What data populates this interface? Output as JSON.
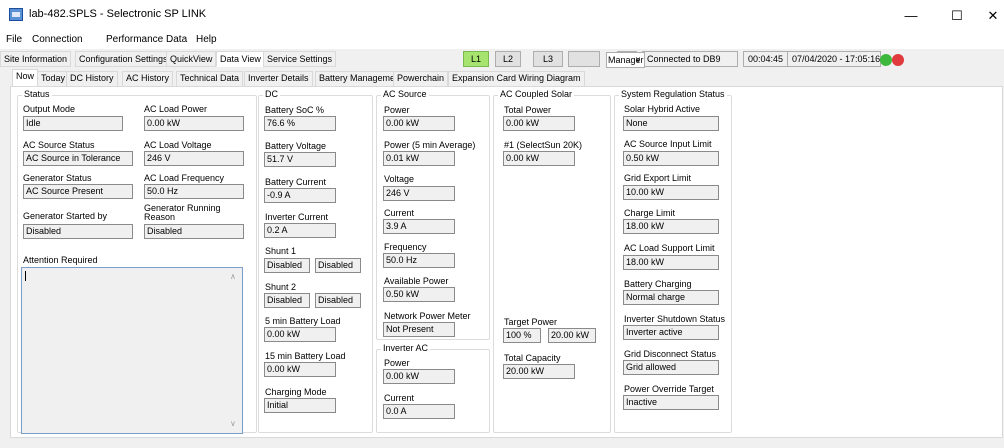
{
  "window": {
    "title": "lab-482.SPLS - Selectronic SP LINK"
  },
  "menu": [
    "File",
    "Connection",
    "Performance Data",
    "Help"
  ],
  "top_tabs": [
    "Site Information",
    "Configuration Settings",
    "QuickView",
    "Data View",
    "Service Settings"
  ],
  "phases": [
    "L1",
    "L2",
    "L3"
  ],
  "status": {
    "l1": "L1",
    "connection": "Connected to DB9",
    "elapsed": "00:04:45",
    "datetime": "07/04/2020 - 17:05:16"
  },
  "user": "Manager",
  "sub_tabs": [
    "Now",
    "Today",
    "DC History",
    "AC History",
    "Technical Data",
    "Inverter Details",
    "Battery Management",
    "Powerchain",
    "Expansion Card Wiring Diagram"
  ],
  "status_group": {
    "title": "Status",
    "output_mode_label": "Output Mode",
    "output_mode": "Idle",
    "ac_load_power_label": "AC Load Power",
    "ac_load_power": "0.00 kW",
    "ac_source_status_label": "AC Source Status",
    "ac_source_status": "AC Source in Tolerance",
    "ac_load_voltage_label": "AC Load Voltage",
    "ac_load_voltage": "246 V",
    "generator_status_label": "Generator Status",
    "generator_status": "AC Source Present",
    "ac_load_frequency_label": "AC Load Frequency",
    "ac_load_frequency": "50.0 Hz",
    "generator_started_by_label": "Generator Started by",
    "generator_started_by": "Disabled",
    "generator_running_reason_label": "Generator Running Reason",
    "generator_running_reason": "Disabled",
    "attention_label": "Attention Required"
  },
  "dc": {
    "title": "DC",
    "soc_label": "Battery SoC %",
    "soc": "76.6 %",
    "voltage_label": "Battery Voltage",
    "voltage": "51.7 V",
    "current_label": "Battery Current",
    "current": "-0.9 A",
    "inverter_current_label": "Inverter Current",
    "inverter_current": "0.2 A",
    "shunt1_label": "Shunt 1",
    "shunt1_a": "Disabled",
    "shunt1_b": "Disabled",
    "shunt2_label": "Shunt 2",
    "shunt2_a": "Disabled",
    "shunt2_b": "Disabled",
    "load5_label": "5 min Battery Load",
    "load5": "0.00 kW",
    "load15_label": "15 min Battery Load",
    "load15": "0.00 kW",
    "charging_mode_label": "Charging Mode",
    "charging_mode": "Initial"
  },
  "ac_source": {
    "title": "AC Source",
    "power_label": "Power",
    "power": "0.00 kW",
    "power5_label": "Power (5 min Average)",
    "power5": "0.01 kW",
    "voltage_label": "Voltage",
    "voltage": "246 V",
    "current_label": "Current",
    "current": "3.9 A",
    "frequency_label": "Frequency",
    "frequency": "50.0 Hz",
    "available_label": "Available Power",
    "available": "0.50 kW",
    "meter_label": "Network Power Meter",
    "meter": "Not Present"
  },
  "inverter_ac": {
    "title": "Inverter AC",
    "power_label": "Power",
    "power": "0.00 kW",
    "current_label": "Current",
    "current": "0.0 A"
  },
  "solar": {
    "title": "AC Coupled Solar",
    "total_power_label": "Total Power",
    "total_power": "0.00 kW",
    "unit1_label": "#1 (SelectSun 20K)",
    "unit1": "0.00 kW",
    "target_label": "Target Power",
    "target_pct": "100 %",
    "target_kw": "20.00 kW",
    "capacity_label": "Total Capacity",
    "capacity": "20.00 kW"
  },
  "regulation": {
    "title": "System Regulation Status",
    "hybrid_label": "Solar Hybrid Active",
    "hybrid": "None",
    "ac_input_label": "AC Source Input Limit",
    "ac_input": "0.50 kW",
    "grid_export_label": "Grid Export Limit",
    "grid_export": "10.00 kW",
    "charge_label": "Charge Limit",
    "charge": "18.00 kW",
    "ac_support_label": "AC Load Support Limit",
    "ac_support": "18.00 kW",
    "battery_charging_label": "Battery Charging",
    "battery_charging": "Normal charge",
    "shutdown_label": "Inverter Shutdown Status",
    "shutdown": "Inverter active",
    "disconnect_label": "Grid Disconnect Status",
    "disconnect": "Grid allowed",
    "override_label": "Power Override Target",
    "override": "Inactive"
  },
  "colors": {
    "phase_active": "#a6e36f",
    "status_ok": "#3db83d",
    "status_err": "#e0393e"
  }
}
